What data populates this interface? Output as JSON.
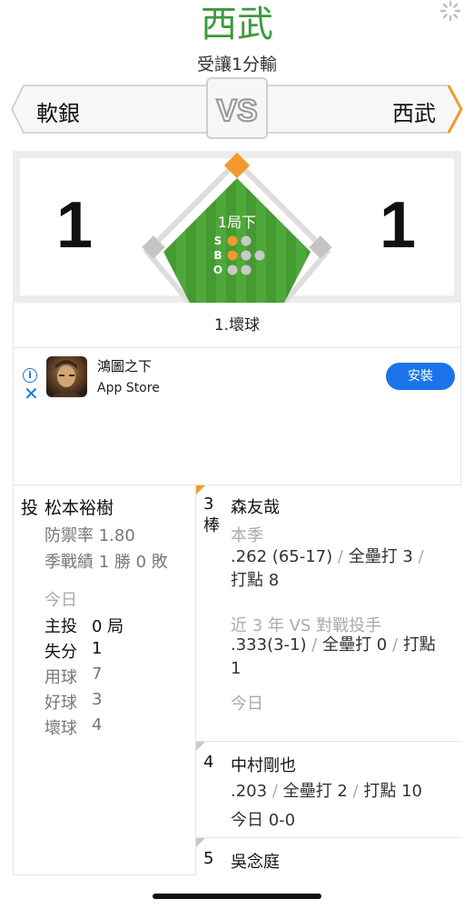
{
  "header": {
    "title": "西武",
    "subtitle": "受讓1分輸"
  },
  "matchup": {
    "away_team": "軟銀",
    "home_team": "西武",
    "vs_label": "VS"
  },
  "score": {
    "away": "1",
    "home": "1",
    "inning": "1局下",
    "sbo_labels": [
      "S",
      "B",
      "O"
    ],
    "strikes": 1,
    "balls": 1,
    "outs": 0,
    "play_description": "1.壞球"
  },
  "colors": {
    "title_green": "#3b9a3b",
    "accent_orange": "#f29a2e",
    "field_green": "#4aa236",
    "install_blue": "#1a73e8"
  },
  "ad": {
    "info_icon": "info-icon",
    "close_icon": "close-icon",
    "title": "鴻圖之下",
    "store": "App Store",
    "install_label": "安裝"
  },
  "pitcher": {
    "role": "投",
    "name": "松本裕樹",
    "era": "防禦率 1.80",
    "record": "季戰績 1 勝 0 敗",
    "today_label": "今日",
    "stats": [
      {
        "label": "主投",
        "value": "0 局",
        "emph": true
      },
      {
        "label": "失分",
        "value": "1",
        "emph": true
      },
      {
        "label": "用球",
        "value": "7",
        "emph": false
      },
      {
        "label": "好球",
        "value": "3",
        "emph": false
      },
      {
        "label": "壞球",
        "value": "4",
        "emph": false
      }
    ]
  },
  "batters": [
    {
      "order_num": "3",
      "order_suffix": "棒",
      "name": "森友哉",
      "season_label": "本季",
      "season_avg": ".262 (65-17)",
      "season_hr": "全壘打 3",
      "season_rbi": "打點 8",
      "vs_label": "近 3 年 VS 對戰投手",
      "vs_avg": ".333(3-1)",
      "vs_hr": "全壘打 0",
      "vs_rbi": "打點",
      "vs_rbi_value": "1",
      "today_label": "今日"
    },
    {
      "order_num": "4",
      "name": "中村剛也",
      "avg": ".203",
      "hr": "全壘打 2",
      "rbi": "打點 10",
      "today": "今日 0-0"
    },
    {
      "order_num": "5",
      "name": "吳念庭"
    }
  ]
}
